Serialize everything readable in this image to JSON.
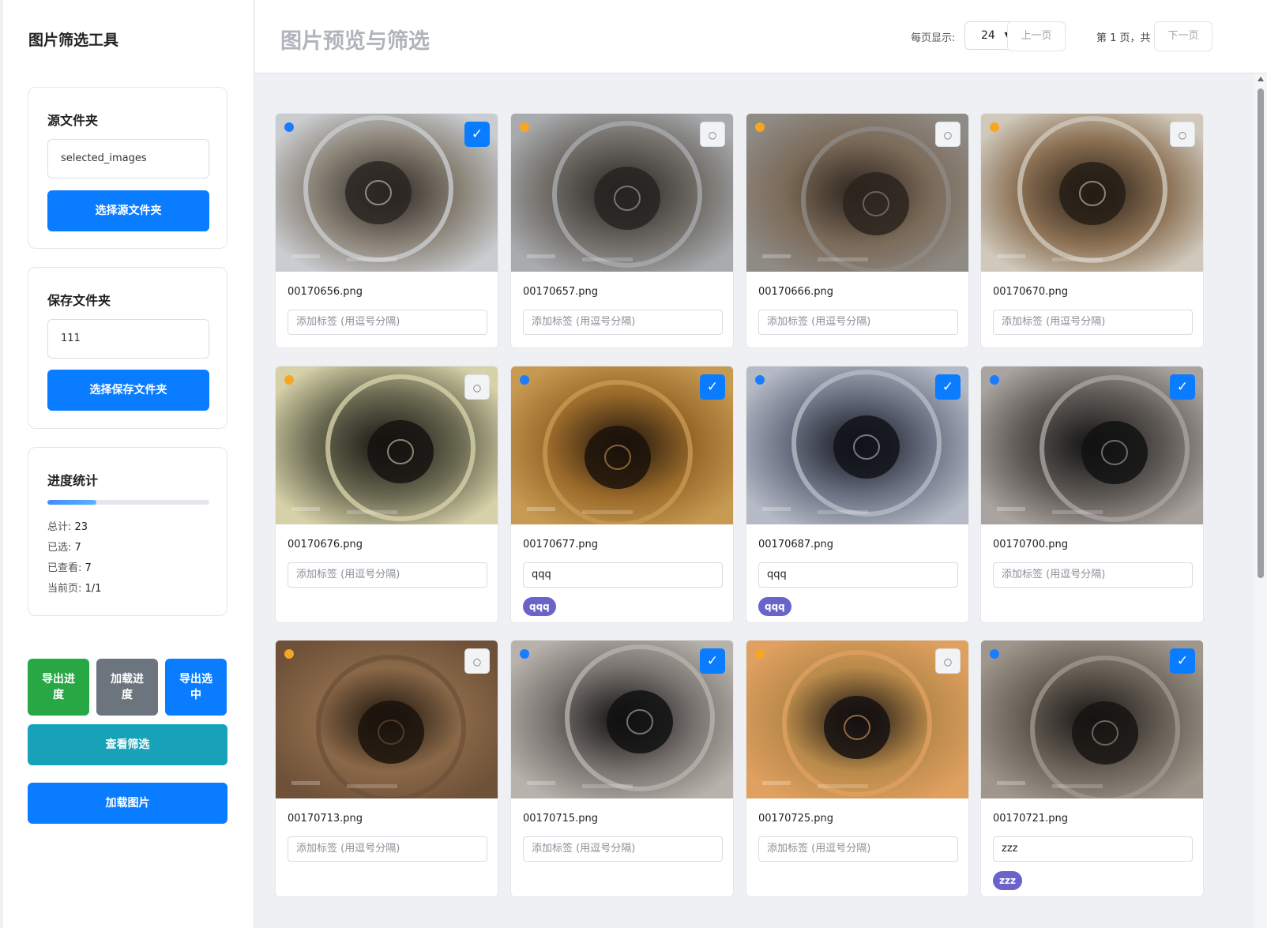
{
  "sidebar": {
    "app_title": "图片筛选工具",
    "source": {
      "title": "源文件夹",
      "path": "selected_images",
      "button": "选择源文件夹"
    },
    "save": {
      "title": "保存文件夹",
      "path": "111",
      "button": "选择保存文件夹"
    },
    "stats": {
      "title": "进度统计",
      "progress": 0.3,
      "total_label": "总计:",
      "total": "23",
      "selected_label": "已选:",
      "selected": "7",
      "viewed_label": "已查看:",
      "viewed": "7",
      "page_label": "当前页:",
      "page": "1/1"
    },
    "actions": {
      "export_progress": "导出进度",
      "load_progress": "加载进度",
      "export_selected": "导出选中",
      "view_filter": "查看筛选",
      "load_images": "加载图片"
    }
  },
  "header": {
    "title": "图片预览与筛选",
    "per_page_label": "每页显示:",
    "per_page_value": "24",
    "prev": "上一页",
    "page_info": "第 1 页，共 1 页",
    "next": "下一页"
  },
  "colors": {
    "primary": "#0a7cff",
    "green": "#28a745",
    "gray": "#6c757d",
    "teal": "#17a2b8",
    "dot_blue": "#1a7cff",
    "dot_orange": "#f5a623",
    "chip": "#6a63c9"
  },
  "tag_placeholder": "添加标签 (用逗号分隔)",
  "check_on_glyph": "✓",
  "check_off_glyph": "○",
  "cards": [
    {
      "file": "00170656.png",
      "selected": true,
      "dot": "blue",
      "tag": "",
      "chip": ""
    },
    {
      "file": "00170657.png",
      "selected": false,
      "dot": "orange",
      "tag": "",
      "chip": ""
    },
    {
      "file": "00170666.png",
      "selected": false,
      "dot": "orange",
      "tag": "",
      "chip": ""
    },
    {
      "file": "00170670.png",
      "selected": false,
      "dot": "orange",
      "tag": "",
      "chip": ""
    },
    {
      "file": "00170676.png",
      "selected": false,
      "dot": "orange",
      "tag": "",
      "chip": ""
    },
    {
      "file": "00170677.png",
      "selected": true,
      "dot": "blue",
      "tag": "qqq",
      "chip": "qqq"
    },
    {
      "file": "00170687.png",
      "selected": true,
      "dot": "blue",
      "tag": "qqq",
      "chip": "qqq"
    },
    {
      "file": "00170700.png",
      "selected": true,
      "dot": "blue",
      "tag": "",
      "chip": ""
    },
    {
      "file": "00170713.png",
      "selected": false,
      "dot": "orange",
      "tag": "",
      "chip": ""
    },
    {
      "file": "00170715.png",
      "selected": true,
      "dot": "blue",
      "tag": "",
      "chip": ""
    },
    {
      "file": "00170725.png",
      "selected": false,
      "dot": "orange",
      "tag": "",
      "chip": ""
    },
    {
      "file": "00170721.png",
      "selected": true,
      "dot": "blue",
      "tag": "zzz",
      "chip": "zzz"
    }
  ]
}
